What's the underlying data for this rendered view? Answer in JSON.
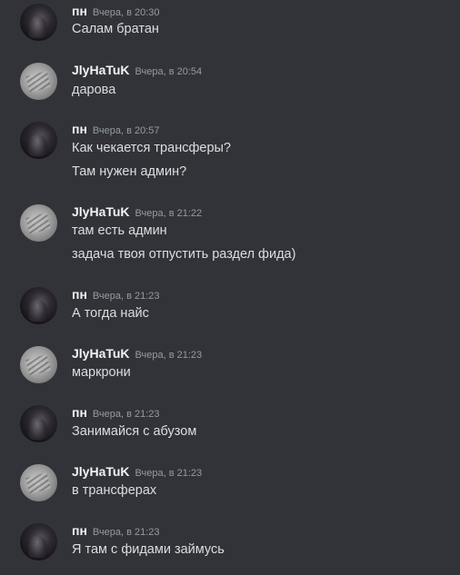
{
  "messages": [
    {
      "author": "пн",
      "time": "Вчера, в 20:30",
      "lines": [
        "Салам братан"
      ]
    },
    {
      "author": "JlyHaTuK",
      "time": "Вчера, в 20:54",
      "lines": [
        "дарова"
      ]
    },
    {
      "author": "пн",
      "time": "Вчера, в 20:57",
      "lines": [
        "Как чекается трансферы?",
        "Там нужен админ?"
      ]
    },
    {
      "author": "JlyHaTuK",
      "time": "Вчера, в 21:22",
      "lines": [
        "там есть админ",
        "задача твоя отпустить раздел фида)"
      ]
    },
    {
      "author": "пн",
      "time": "Вчера, в 21:23",
      "lines": [
        "А тогда найс"
      ]
    },
    {
      "author": "JlyHaTuK",
      "time": "Вчера, в 21:23",
      "lines": [
        "маркрони"
      ]
    },
    {
      "author": "пн",
      "time": "Вчера, в 21:23",
      "lines": [
        "Занимайся с абузом"
      ]
    },
    {
      "author": "JlyHaTuK",
      "time": "Вчера, в 21:23",
      "lines": [
        "в трансферах"
      ]
    },
    {
      "author": "пн",
      "time": "Вчера, в 21:23",
      "lines": [
        "Я там с фидами займусь"
      ]
    }
  ]
}
